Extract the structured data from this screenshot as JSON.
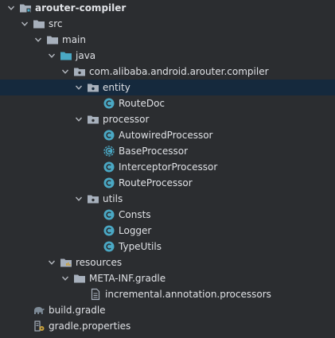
{
  "tree": {
    "items": [
      {
        "label": "arouter-compiler",
        "icon": "module-folder-icon",
        "expanded": true,
        "bold": true
      },
      {
        "label": "src",
        "icon": "folder-icon",
        "expanded": true
      },
      {
        "label": "main",
        "icon": "folder-icon",
        "expanded": true
      },
      {
        "label": "java",
        "icon": "source-root-folder-icon",
        "expanded": true
      },
      {
        "label": "com.alibaba.android.arouter.compiler",
        "icon": "package-icon",
        "expanded": true
      },
      {
        "label": "entity",
        "icon": "package-icon",
        "expanded": true,
        "selected": true
      },
      {
        "label": "RouteDoc",
        "icon": "class-icon"
      },
      {
        "label": "processor",
        "icon": "package-icon",
        "expanded": true
      },
      {
        "label": "AutowiredProcessor",
        "icon": "class-icon"
      },
      {
        "label": "BaseProcessor",
        "icon": "abstract-class-icon"
      },
      {
        "label": "InterceptorProcessor",
        "icon": "class-icon"
      },
      {
        "label": "RouteProcessor",
        "icon": "class-icon"
      },
      {
        "label": "utils",
        "icon": "package-icon",
        "expanded": true
      },
      {
        "label": "Consts",
        "icon": "class-icon"
      },
      {
        "label": "Logger",
        "icon": "class-icon"
      },
      {
        "label": "TypeUtils",
        "icon": "class-icon"
      },
      {
        "label": "resources",
        "icon": "resources-folder-icon",
        "expanded": true
      },
      {
        "label": "META-INF.gradle",
        "icon": "folder-icon",
        "expanded": true
      },
      {
        "label": "incremental.annotation.processors",
        "icon": "file-icon"
      },
      {
        "label": "build.gradle",
        "icon": "gradle-elephant-icon"
      },
      {
        "label": "gradle.properties",
        "icon": "gradle-properties-icon"
      }
    ]
  },
  "colors": {
    "background": "#2b2d30",
    "selected_row": "#15293d",
    "text": "#dfe1e5",
    "folder": "#a7b0bc",
    "class_icon": "#4aa8c4",
    "gradle": "#7d8a96"
  }
}
